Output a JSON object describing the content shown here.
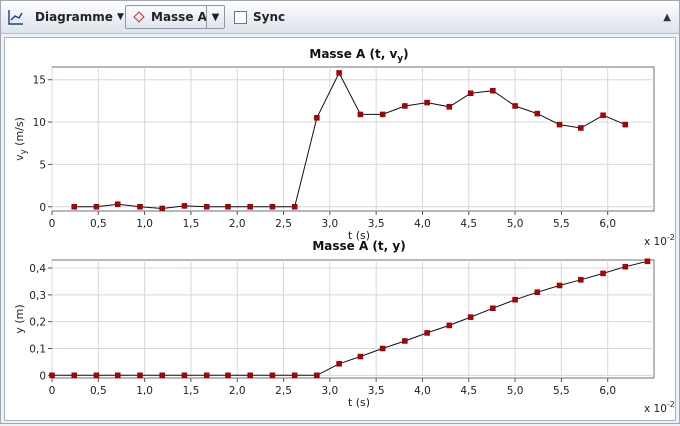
{
  "toolbar": {
    "chart_icon": "chart-icon",
    "diagram_label": "Diagramme",
    "mass_label": "Masse A",
    "sync_label": "Sync"
  },
  "chart_data": [
    {
      "type": "line",
      "title": "Masse A (t, v",
      "title_sub": "y",
      "title_end": ")",
      "xlabel": "t (s)",
      "ylabel_main": "v",
      "ylabel_sub": "y",
      "ylabel_end": " (m/s)",
      "x_multiplier": "x 10",
      "x_multiplier_exp": "-2",
      "xlim": [
        0,
        6.5
      ],
      "ylim": [
        -0.5,
        16.5
      ],
      "xticks": [
        "0",
        "0,5",
        "1,0",
        "1,5",
        "2,0",
        "2,5",
        "3,0",
        "3,5",
        "4,0",
        "4,5",
        "5,0",
        "5,5",
        "6,0"
      ],
      "xtick_values": [
        0,
        0.5,
        1,
        1.5,
        2,
        2.5,
        3,
        3.5,
        4,
        4.5,
        5,
        5.5,
        6
      ],
      "yticks": [
        "0",
        "5",
        "10",
        "15"
      ],
      "ytick_values": [
        0,
        5,
        10,
        15
      ],
      "grid": true,
      "series": [
        {
          "color": "#b00000",
          "x": [
            0.24,
            0.48,
            0.71,
            0.95,
            1.19,
            1.43,
            1.67,
            1.9,
            2.14,
            2.38,
            2.62,
            2.86,
            3.1,
            3.33,
            3.57,
            3.81,
            4.05,
            4.29,
            4.52,
            4.76,
            5.0,
            5.24,
            5.48,
            5.71,
            5.95,
            6.19
          ],
          "y": [
            0.0,
            0.0,
            0.3,
            0.0,
            -0.2,
            0.1,
            0.0,
            0.0,
            0.0,
            0.0,
            0.0,
            10.5,
            15.8,
            10.9,
            10.9,
            11.9,
            12.3,
            11.8,
            13.4,
            13.7,
            11.9,
            11.0,
            9.7,
            9.3,
            10.8,
            9.7
          ]
        }
      ]
    },
    {
      "type": "line",
      "title": "Masse A (t, y)",
      "xlabel": "t (s)",
      "ylabel": "y (m)",
      "x_multiplier": "x 10",
      "x_multiplier_exp": "-2",
      "xlim": [
        0,
        6.5
      ],
      "ylim": [
        -0.01,
        0.43
      ],
      "xticks": [
        "0",
        "0,5",
        "1,0",
        "1,5",
        "2,0",
        "2,5",
        "3,0",
        "3,5",
        "4,0",
        "4,5",
        "5,0",
        "5,5",
        "6,0"
      ],
      "xtick_values": [
        0,
        0.5,
        1,
        1.5,
        2,
        2.5,
        3,
        3.5,
        4,
        4.5,
        5,
        5.5,
        6
      ],
      "yticks": [
        "0",
        "0,1",
        "0,2",
        "0,3",
        "0,4"
      ],
      "ytick_values": [
        0,
        0.1,
        0.2,
        0.3,
        0.4
      ],
      "grid": true,
      "series": [
        {
          "color": "#b00000",
          "x": [
            0.0,
            0.24,
            0.48,
            0.71,
            0.95,
            1.19,
            1.43,
            1.67,
            1.9,
            2.14,
            2.38,
            2.62,
            2.86,
            3.1,
            3.33,
            3.57,
            3.81,
            4.05,
            4.29,
            4.52,
            4.76,
            5.0,
            5.24,
            5.48,
            5.71,
            5.95,
            6.19,
            6.43
          ],
          "y": [
            0.0,
            0.0,
            0.0,
            0.0,
            0.0,
            0.0,
            0.0,
            0.0,
            0.0,
            0.0,
            0.0,
            0.0,
            0.0,
            0.043,
            0.07,
            0.1,
            0.128,
            0.158,
            0.186,
            0.217,
            0.25,
            0.282,
            0.31,
            0.335,
            0.356,
            0.38,
            0.405,
            0.425
          ]
        }
      ]
    }
  ]
}
